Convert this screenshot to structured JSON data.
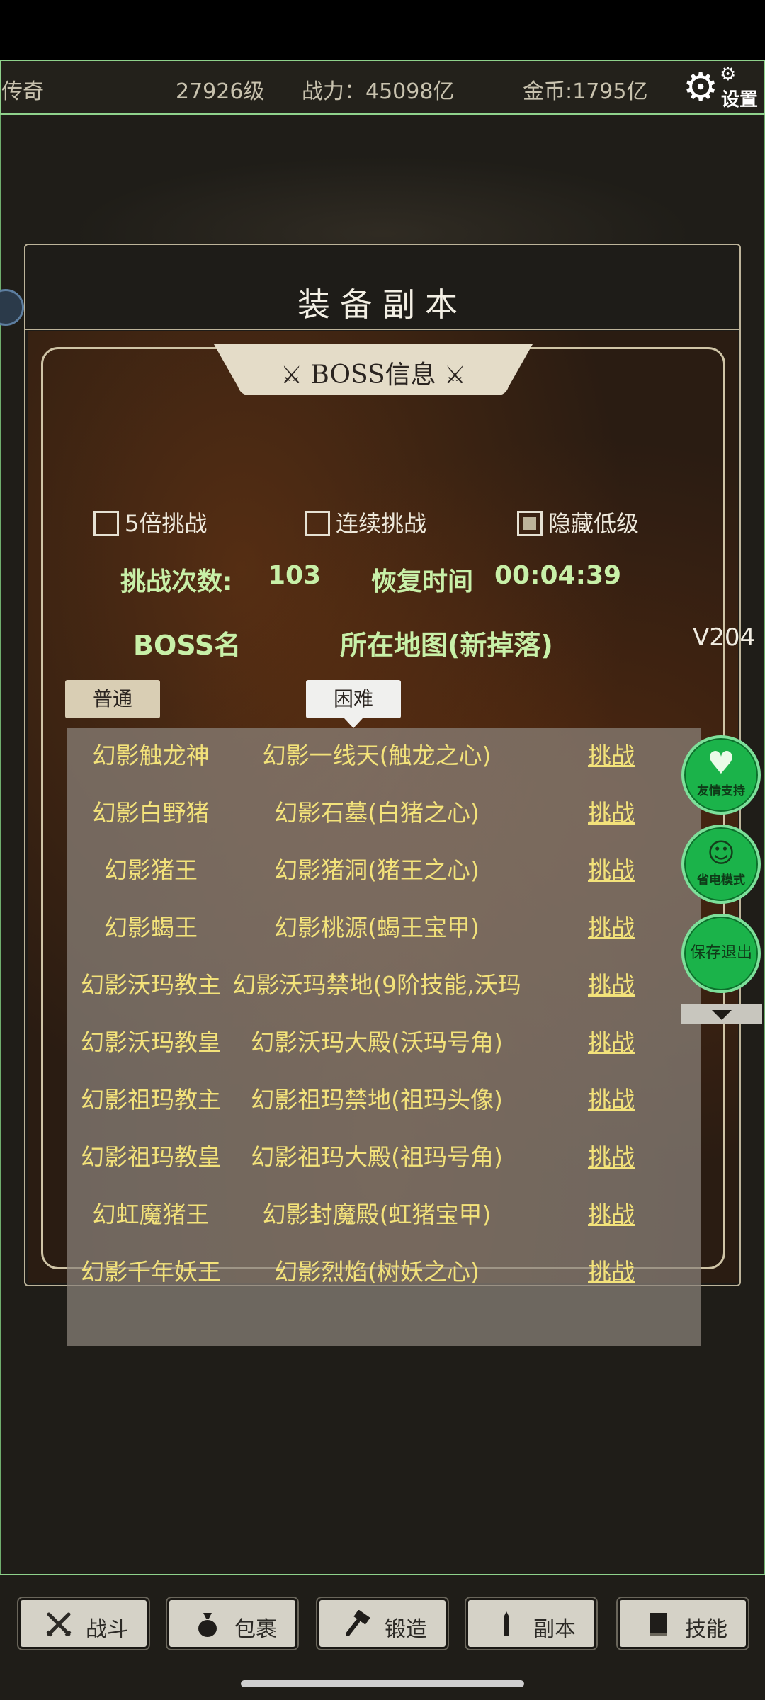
{
  "header": {
    "name": "传奇",
    "level": "27926级",
    "power": "战力：45098亿",
    "gold": "金币:1795亿",
    "settings_label": "设置"
  },
  "dialog": {
    "title": "装备副本",
    "banner": "BOSS信息",
    "checkboxes": [
      {
        "label": "5倍挑战",
        "checked": false
      },
      {
        "label": "连续挑战",
        "checked": false
      },
      {
        "label": "隐藏低级",
        "checked": true
      }
    ],
    "challenge_label": "挑战次数:",
    "challenge_count": "103",
    "recover_label": "恢复时间",
    "recover_time": "00:04:39",
    "col_boss": "BOSS名",
    "col_map": "所在地图(新掉落)",
    "diff_normal": "普通",
    "diff_hard": "困难",
    "rows": [
      {
        "name": "幻影触龙神",
        "map": "幻影一线天(触龙之心)",
        "action": "挑战"
      },
      {
        "name": "幻影白野猪",
        "map": "幻影石墓(白猪之心)",
        "action": "挑战"
      },
      {
        "name": "幻影猪王",
        "map": "幻影猪洞(猪王之心)",
        "action": "挑战"
      },
      {
        "name": "幻影蝎王",
        "map": "幻影桃源(蝎王宝甲)",
        "action": "挑战"
      },
      {
        "name": "幻影沃玛教主",
        "map": "幻影沃玛禁地(9阶技能,沃玛",
        "action": "挑战"
      },
      {
        "name": "幻影沃玛教皇",
        "map": "幻影沃玛大殿(沃玛号角)",
        "action": "挑战"
      },
      {
        "name": "幻影祖玛教主",
        "map": "幻影祖玛禁地(祖玛头像)",
        "action": "挑战"
      },
      {
        "name": "幻影祖玛教皇",
        "map": "幻影祖玛大殿(祖玛号角)",
        "action": "挑战"
      },
      {
        "name": "幻虹魔猪王",
        "map": "幻影封魔殿(虹猪宝甲)",
        "action": "挑战"
      },
      {
        "name": "幻影千年妖王",
        "map": "幻影烈焰(树妖之心)",
        "action": "挑战"
      }
    ]
  },
  "side": {
    "version": "V204",
    "btn_support": "友情支持",
    "btn_power_save": "省电模式",
    "btn_save_exit": "保存退出"
  },
  "nav": [
    {
      "label": "战斗",
      "icon": "crossed-swords-icon"
    },
    {
      "label": "包裹",
      "icon": "bag-icon"
    },
    {
      "label": "锻造",
      "icon": "hammer-icon"
    },
    {
      "label": "副本",
      "icon": "tower-icon"
    },
    {
      "label": "技能",
      "icon": "book-icon"
    }
  ],
  "colors": {
    "accent_green": "#1bb34a",
    "list_text": "#f3e27a",
    "header_text": "#c8f0a8"
  }
}
